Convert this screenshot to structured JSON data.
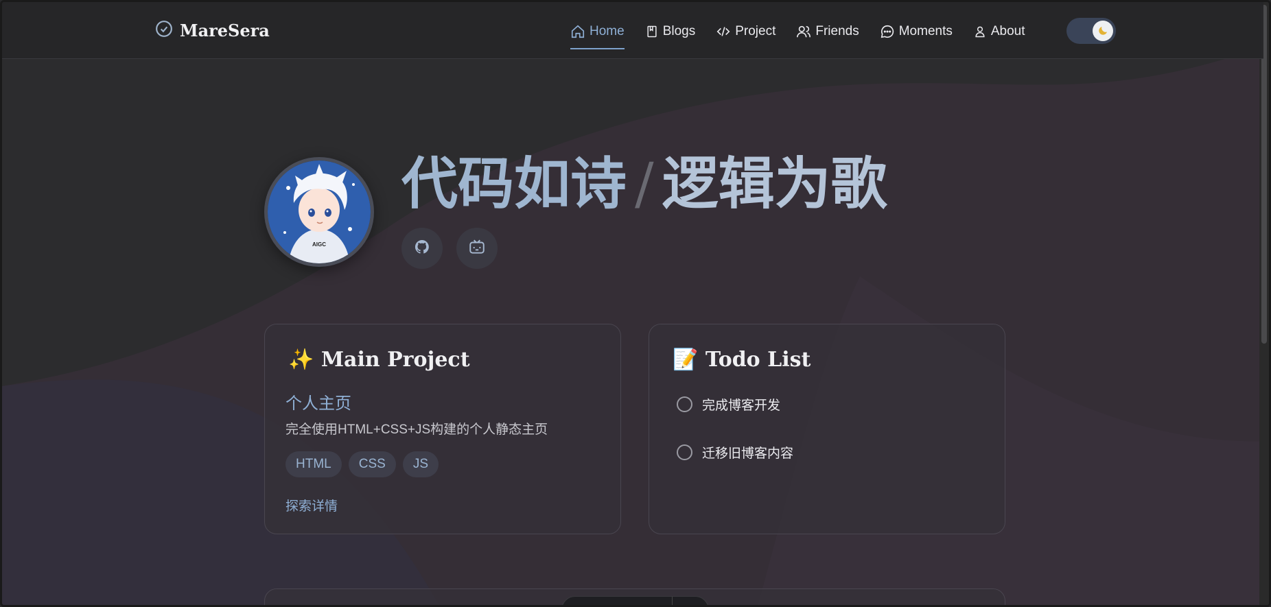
{
  "brand": {
    "name": "MareSera",
    "icon": "check-circle-icon"
  },
  "nav": {
    "items": [
      {
        "label": "Home",
        "icon": "home-icon",
        "active": true
      },
      {
        "label": "Blogs",
        "icon": "book-icon",
        "active": false
      },
      {
        "label": "Project",
        "icon": "code-icon",
        "active": false
      },
      {
        "label": "Friends",
        "icon": "users-icon",
        "active": false
      },
      {
        "label": "Moments",
        "icon": "message-icon",
        "active": false
      },
      {
        "label": "About",
        "icon": "user-icon",
        "active": false
      }
    ]
  },
  "theme_toggle": {
    "icon": "moon-icon",
    "state": "dark"
  },
  "hero": {
    "title_part1": "代码如诗",
    "separator": "/",
    "title_part2": "逻辑为歌",
    "avatar_text": "AIGC",
    "social": [
      {
        "icon": "github-icon"
      },
      {
        "icon": "bilibili-icon"
      }
    ]
  },
  "project_card": {
    "emoji": "✨",
    "title": "Main Project",
    "name": "个人主页",
    "description": "完全使用HTML+CSS+JS构建的个人静态主页",
    "tags": [
      "HTML",
      "CSS",
      "JS"
    ],
    "link_label": "探索详情"
  },
  "todo_card": {
    "emoji": "📝",
    "title": "Todo List",
    "items": [
      {
        "label": "完成博客开发",
        "done": false
      },
      {
        "label": "迁移旧博客内容",
        "done": false
      }
    ]
  },
  "colors": {
    "accent": "#8fb0d6",
    "background": "#2b2b2d",
    "card": "#343038"
  }
}
